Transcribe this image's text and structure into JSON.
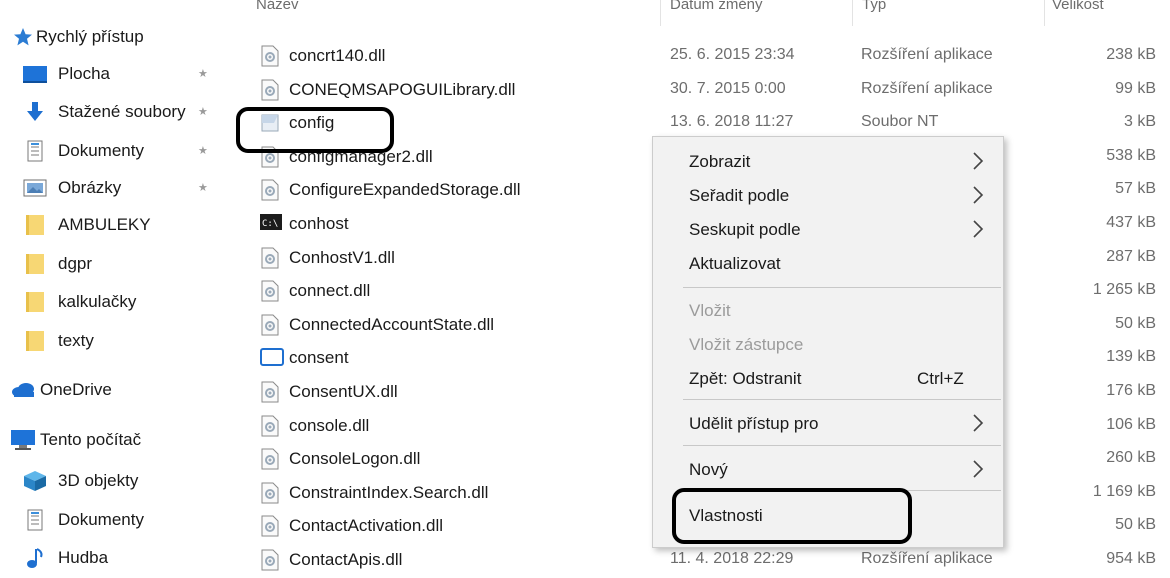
{
  "nav": {
    "items": [
      {
        "label": "Rychlý přístup",
        "icon": "star-icon",
        "pinned": false
      },
      {
        "label": "Plocha",
        "icon": "desktop-icon",
        "pinned": true
      },
      {
        "label": "Stažené soubory",
        "icon": "download-icon",
        "pinned": true
      },
      {
        "label": "Dokumenty",
        "icon": "document-icon",
        "pinned": true
      },
      {
        "label": "Obrázky",
        "icon": "pictures-icon",
        "pinned": true
      },
      {
        "label": "AMBULEKY",
        "icon": "folder-icon",
        "pinned": false
      },
      {
        "label": "dgpr",
        "icon": "folder-icon",
        "pinned": false
      },
      {
        "label": "kalkulačky",
        "icon": "folder-icon",
        "pinned": false
      },
      {
        "label": "texty",
        "icon": "folder-icon",
        "pinned": false
      },
      {
        "label": "OneDrive",
        "icon": "cloud-icon",
        "pinned": false
      },
      {
        "label": "Tento počítač",
        "icon": "computer-icon",
        "pinned": false
      },
      {
        "label": "3D objekty",
        "icon": "3d-objects-icon",
        "pinned": false
      },
      {
        "label": "Dokumenty",
        "icon": "document-icon",
        "pinned": false
      },
      {
        "label": "Hudba",
        "icon": "music-icon",
        "pinned": false
      }
    ]
  },
  "columns": {
    "name": "Název",
    "date": "Datum změny",
    "type": "Typ",
    "size": "Velikost"
  },
  "files": [
    {
      "name": "concrt140.dll",
      "date": "25. 6. 2015 23:34",
      "type": "Rozšíření aplikace",
      "size": "238 kB",
      "icon": "dll-icon"
    },
    {
      "name": "CONEQMSAPOGUILibrary.dll",
      "date": "30. 7. 2015 0:00",
      "type": "Rozšíření aplikace",
      "size": "99 kB",
      "icon": "dll-icon"
    },
    {
      "name": "config",
      "date": "13. 6. 2018 11:27",
      "type": "Soubor NT",
      "size": "3 kB",
      "icon": "nt-file-icon"
    },
    {
      "name": "configmanager2.dll",
      "date": "",
      "type": "",
      "size": "538 kB",
      "icon": "dll-icon"
    },
    {
      "name": "ConfigureExpandedStorage.dll",
      "date": "",
      "type": "",
      "size": "57 kB",
      "icon": "dll-icon"
    },
    {
      "name": "conhost",
      "date": "",
      "type": "",
      "size": "437 kB",
      "icon": "console-icon"
    },
    {
      "name": "ConhostV1.dll",
      "date": "",
      "type": "",
      "size": "287 kB",
      "icon": "dll-icon"
    },
    {
      "name": "connect.dll",
      "date": "",
      "type": "",
      "size": "1 265 kB",
      "icon": "dll-icon"
    },
    {
      "name": "ConnectedAccountState.dll",
      "date": "",
      "type": "",
      "size": "50 kB",
      "icon": "dll-icon"
    },
    {
      "name": "consent",
      "date": "",
      "type": "",
      "size": "139 kB",
      "icon": "window-icon"
    },
    {
      "name": "ConsentUX.dll",
      "date": "",
      "type": "",
      "size": "176 kB",
      "icon": "dll-icon"
    },
    {
      "name": "console.dll",
      "date": "",
      "type": "",
      "size": "106 kB",
      "icon": "dll-icon"
    },
    {
      "name": "ConsoleLogon.dll",
      "date": "",
      "type": "",
      "size": "260 kB",
      "icon": "dll-icon"
    },
    {
      "name": "ConstraintIndex.Search.dll",
      "date": "",
      "type": "",
      "size": "1 169 kB",
      "icon": "dll-icon"
    },
    {
      "name": "ContactActivation.dll",
      "date": "",
      "type": "",
      "size": "50 kB",
      "icon": "dll-icon"
    },
    {
      "name": "ContactApis.dll",
      "date": "11. 4. 2018 22:29",
      "type": "Rozšíření aplikace",
      "size": "954 kB",
      "icon": "dll-icon"
    }
  ],
  "context_menu": {
    "items": [
      {
        "label": "Zobrazit",
        "submenu": true,
        "disabled": false,
        "shortcut": ""
      },
      {
        "label": "Seřadit podle",
        "submenu": true,
        "disabled": false,
        "shortcut": ""
      },
      {
        "label": "Seskupit podle",
        "submenu": true,
        "disabled": false,
        "shortcut": ""
      },
      {
        "label": "Aktualizovat",
        "submenu": false,
        "disabled": false,
        "shortcut": ""
      },
      {
        "label": "Vložit",
        "submenu": false,
        "disabled": true,
        "shortcut": ""
      },
      {
        "label": "Vložit zástupce",
        "submenu": false,
        "disabled": true,
        "shortcut": ""
      },
      {
        "label": "Zpět: Odstranit",
        "submenu": false,
        "disabled": false,
        "shortcut": "Ctrl+Z"
      },
      {
        "label": "Udělit přístup pro",
        "submenu": true,
        "disabled": false,
        "shortcut": ""
      },
      {
        "label": "Nový",
        "submenu": true,
        "disabled": false,
        "shortcut": ""
      },
      {
        "label": "Vlastnosti",
        "submenu": false,
        "disabled": false,
        "shortcut": ""
      }
    ]
  },
  "colors": {
    "accent": "#1e6fd0",
    "folder": "#f7d774",
    "annotation": "#000000"
  }
}
